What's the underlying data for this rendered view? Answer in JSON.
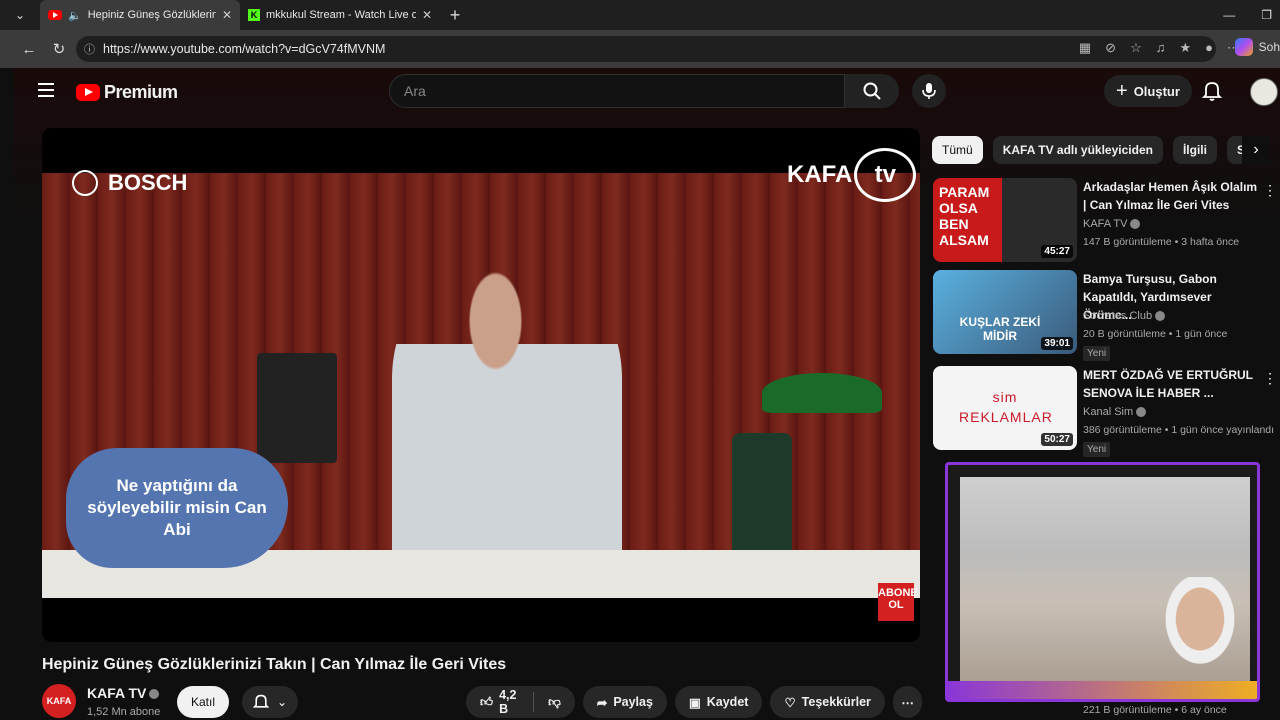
{
  "browser": {
    "tabs": [
      {
        "title": "Hepiniz Güneş Gözlüklerinizi T",
        "favicon": "youtube-icon"
      },
      {
        "title": "mkkukul Stream - Watch Live on K",
        "favicon": "kick-icon"
      }
    ],
    "url": "https://www.youtube.com/watch?v=dGcV74fMVNM",
    "copilot_label": "Soh"
  },
  "youtube": {
    "logo_text": "Premium",
    "search_placeholder": "Ara",
    "create_label": "Oluştur"
  },
  "video": {
    "overlay_brand_left": "BOSCH",
    "overlay_brand_right": "KAFA",
    "overlay_brand_right_tv": "tv",
    "speech_bubble": "Ne yaptığını da söyleyebilir misin Can Abi",
    "abone_badge": "ABONE OL",
    "title": "Hepiniz Güneş Gözlüklerinizi Takın | Can Yılmaz İle Geri Vites",
    "channel_name": "KAFA TV",
    "channel_subs": "1,52 Mn abone",
    "channel_avatar_text": "KAFA",
    "join_label": "Katıl",
    "like_count": "4,2 B",
    "share_label": "Paylaş",
    "save_label": "Kaydet",
    "thanks_label": "Teşekkürler"
  },
  "chips": [
    "Tümü",
    "KAFA TV adlı yükleyiciden",
    "İlgili",
    "Si"
  ],
  "recommendations": [
    {
      "title": "Arkadaşlar Hemen Âşık Olalım | Can Yılmaz İle Geri Vites",
      "channel": "KAFA TV",
      "meta": "147 B görüntüleme • 3 hafta önce",
      "duration": "45:27",
      "thumb_text": "PARAM OLSA BEN ALSAM",
      "new": ""
    },
    {
      "title": "Bamya Turşusu, Gabon Kapatıldı, Yardımsever Örümc...",
      "channel": "Socrates Club",
      "meta": "20 B görüntüleme • 1 gün önce",
      "duration": "39:01",
      "thumb_text": "KUŞLAR ZEKİ MİDİR",
      "new": "Yeni"
    },
    {
      "title": "MERT ÖZDAĞ VE ERTUĞRUL SENOVA İLE HABER ...",
      "channel": "Kanal Sim",
      "meta": "386 görüntüleme • 1 gün önce yayınlandı",
      "duration": "50:27",
      "thumb_text": "sim REKLAMLAR",
      "new": "Yeni"
    }
  ],
  "partial_rec_meta": "221 B görüntüleme • 6 ay önce"
}
